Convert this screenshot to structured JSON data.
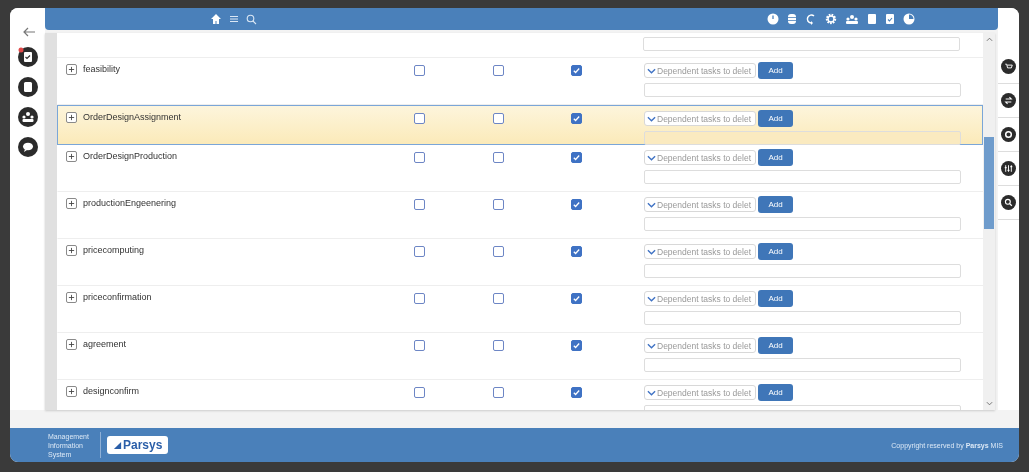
{
  "rows": [
    {
      "name": "feasibility",
      "selected": false,
      "flags": [
        false,
        false,
        true
      ],
      "dependents_placeholder": "Dependent tasks to delet",
      "add_label": "Add"
    },
    {
      "name": "OrderDesignAssignment",
      "selected": true,
      "flags": [
        false,
        false,
        true
      ],
      "dependents_placeholder": "Dependent tasks to delet",
      "add_label": "Add"
    },
    {
      "name": "OrderDesignProduction",
      "selected": false,
      "flags": [
        false,
        false,
        true
      ],
      "dependents_placeholder": "Dependent tasks to delet",
      "add_label": "Add"
    },
    {
      "name": "productionEngeenering",
      "selected": false,
      "flags": [
        false,
        false,
        true
      ],
      "dependents_placeholder": "Dependent tasks to delet",
      "add_label": "Add"
    },
    {
      "name": "pricecomputing",
      "selected": false,
      "flags": [
        false,
        false,
        true
      ],
      "dependents_placeholder": "Dependent tasks to delet",
      "add_label": "Add"
    },
    {
      "name": "priceconfirmation",
      "selected": false,
      "flags": [
        false,
        false,
        true
      ],
      "dependents_placeholder": "Dependent tasks to delet",
      "add_label": "Add"
    },
    {
      "name": "agreement",
      "selected": false,
      "flags": [
        false,
        false,
        true
      ],
      "dependents_placeholder": "Dependent tasks to delet",
      "add_label": "Add"
    },
    {
      "name": "designconfirm",
      "selected": false,
      "flags": [
        false,
        false,
        true
      ],
      "dependents_placeholder": "Dependent tasks to delet",
      "add_label": "Add"
    }
  ],
  "footer": {
    "system_name": "Management Information System",
    "logo_text": "Parsys",
    "copyright": "Coppyright reserved by **Parsys** MIS"
  }
}
